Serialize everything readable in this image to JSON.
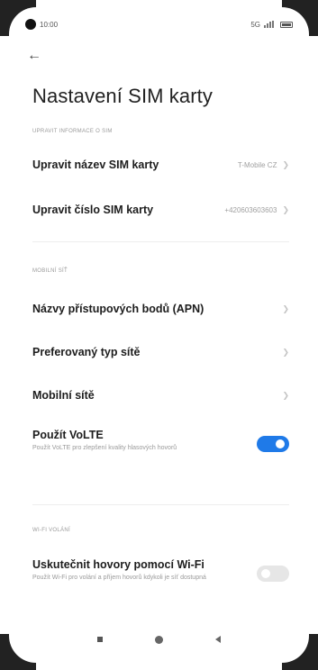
{
  "status_bar": {
    "time": "10:00",
    "network": "5G"
  },
  "title": "Nastavení SIM karty",
  "sections": {
    "sim_info": {
      "header": "UPRAVIT INFORMACE O SIM",
      "rows": [
        {
          "label": "Upravit název SIM karty",
          "value": "T-Mobile CZ"
        },
        {
          "label": "Upravit číslo SIM karty",
          "value": "+420603603603"
        }
      ]
    },
    "mobile_network": {
      "header": "MOBILNÍ SÍŤ",
      "rows": [
        {
          "label": "Názvy přístupových bodů (APN)"
        },
        {
          "label": "Preferovaný typ sítě"
        },
        {
          "label": "Mobilní sítě"
        }
      ],
      "volte": {
        "label": "Použít VoLTE",
        "description": "Použít VoLTE pro zlepšení kvality hlasových hovorů",
        "enabled": true
      }
    },
    "wifi_calling": {
      "header": "WI-FI VOLÁNÍ",
      "toggle": {
        "label": "Uskutečnit hovory pomocí Wi-Fi",
        "description": "Použít Wi-Fi pro volání a příjem hovorů kdykoli je síť dostupná",
        "enabled": false
      }
    }
  },
  "colors": {
    "accent": "#1f7ae8",
    "toggle_off": "#e6e6e6"
  }
}
